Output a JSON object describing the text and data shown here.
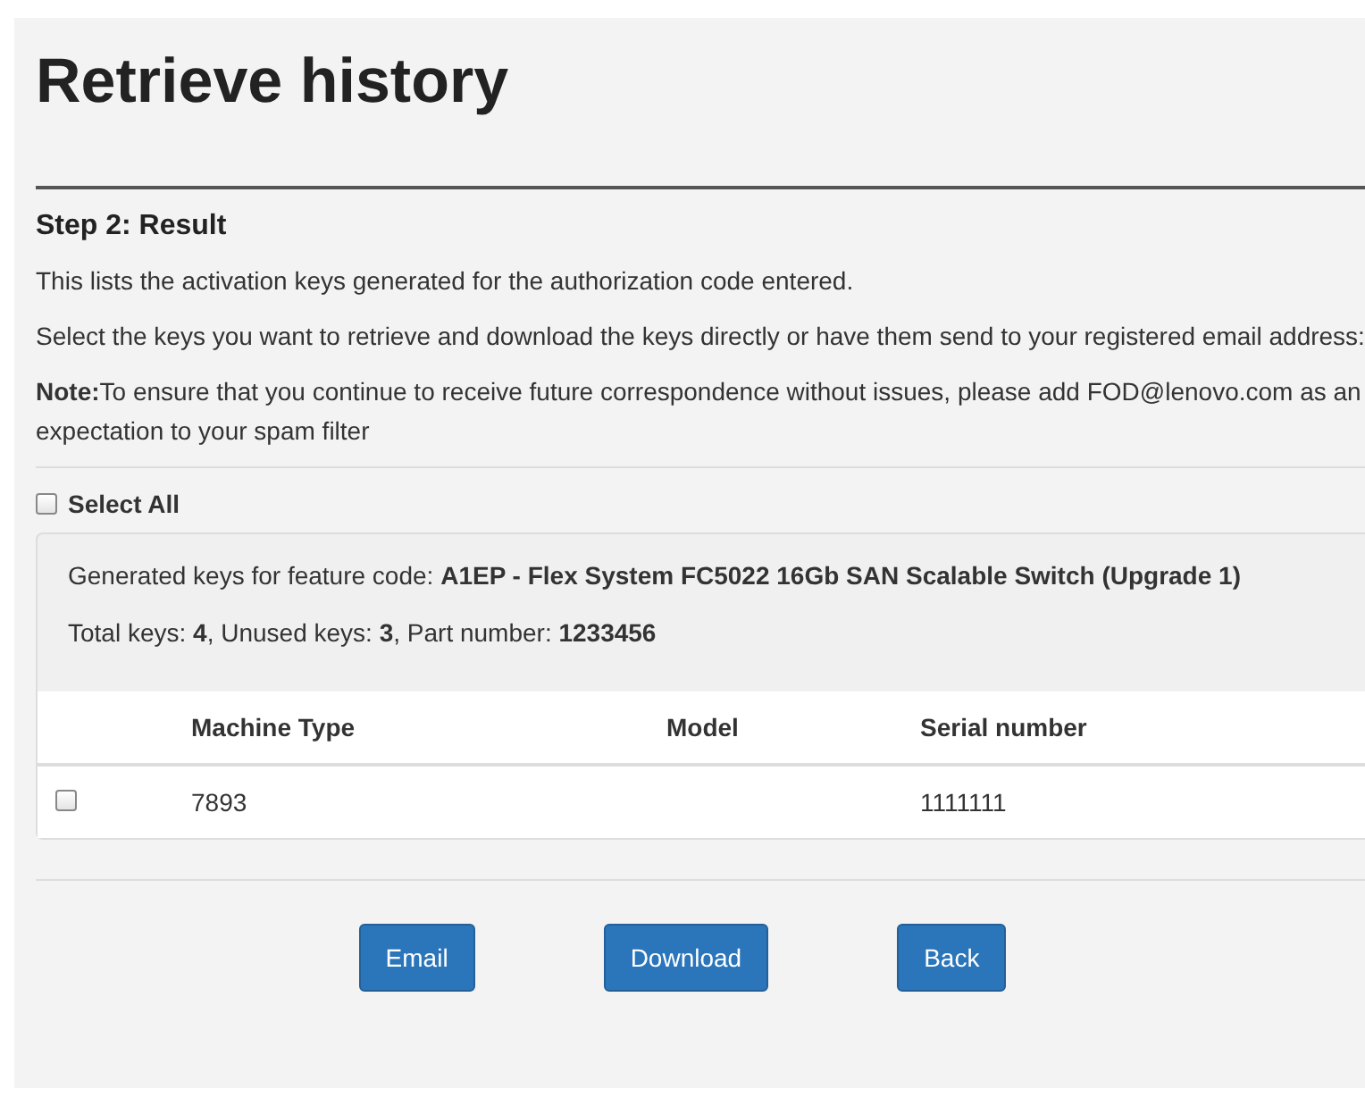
{
  "title": "Retrieve history",
  "step_heading": "Step 2: Result",
  "paragraphs": [
    "This lists the activation keys generated for the authorization code entered.",
    "Select the keys you want to retrieve and download the keys directly or have them send to your registered email address:",
    "**Note:**To ensure that you continue to receive future correspondence without issues, please add FOD@lenovo.com as an expectation to your spam filter"
  ],
  "select_all": {
    "label": "Select All",
    "checked": false
  },
  "panel": {
    "feature_line": "Generated keys for feature code: **A1EP - Flex System FC5022 16Gb SAN Scalable Switch (Upgrade 1)**",
    "totals_line": "Total keys: **4**, Unused keys: **3**, Part number: **1233456**",
    "table": {
      "columns": [
        "Machine Type",
        "Model",
        "Serial number"
      ],
      "rows": [
        {
          "checked": false,
          "cells": [
            "7893",
            "",
            "1111111"
          ]
        }
      ]
    }
  },
  "buttons": [
    "Email",
    "Download",
    "Back"
  ]
}
